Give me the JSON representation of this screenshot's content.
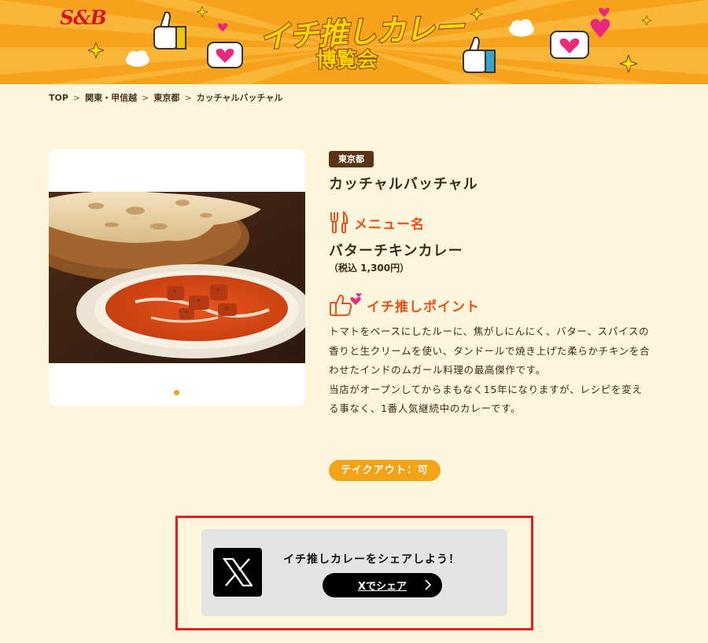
{
  "header": {
    "brand": "S&B",
    "campaign_title": "イチ推しカレー",
    "campaign_subtitle": "博覧会",
    "colors": {
      "background": "#f6a21a",
      "brand_red": "#d8141b",
      "title_yellow": "#ffd400"
    }
  },
  "breadcrumb": {
    "items": [
      "TOP",
      "関東・甲信越",
      "東京都",
      "カッチャルバッチャル"
    ],
    "separator": ">"
  },
  "shop": {
    "prefecture": "東京都",
    "name": "カッチャルバッチャル"
  },
  "menu": {
    "heading": "メニュー名",
    "heading_icon": "fork-knife-icon",
    "name": "バターチキンカレー",
    "price": "（税込 1,300円）"
  },
  "point": {
    "heading": "イチ推しポイント",
    "heading_icon": "thumbs-up-heart-icon",
    "description_1": "トマトをベースにしたルーに、焦がしにんにく、バター、スパイスの香りと生クリームを使い、タンドールで焼き上げた柔らかチキンを合わせたインドのムガール料理の最高傑作です。",
    "description_2": "当店がオープンしてからまもなく15年になりますが、レシピを変える事なく、1番人気継続中のカレーです。"
  },
  "takeout": "テイクアウト：可",
  "gallery": {
    "image": "butter-chicken-curry-with-naan",
    "current_slide": 1,
    "total_slides": 1
  },
  "share": {
    "title": "イチ推しカレーをシェアしよう！",
    "button_label": "Xでシェア",
    "logo_icon": "x-logo-icon",
    "highlight_color": "#e21e1e"
  },
  "colors": {
    "page_background": "#fdf6dc",
    "accent_orange": "#e9501a",
    "badge_brown": "#5b3416",
    "takeout_orange": "#f5a316"
  }
}
